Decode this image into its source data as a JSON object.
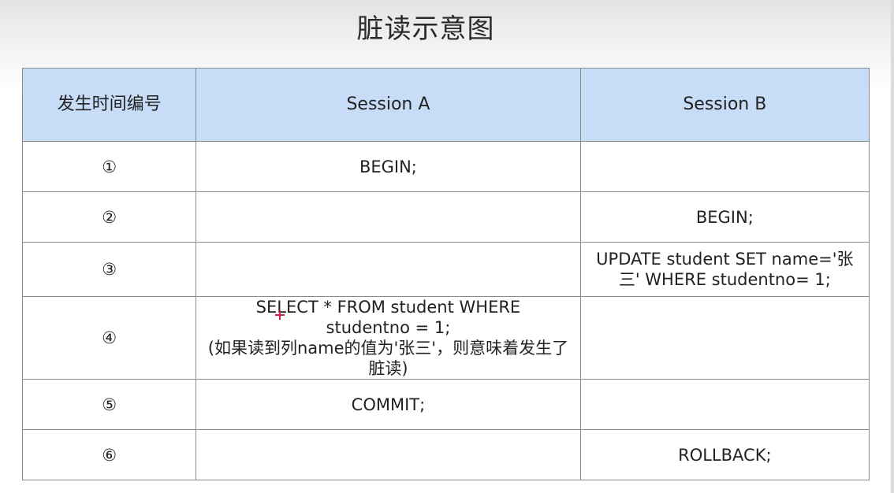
{
  "slide": {
    "title": "脏读示意图"
  },
  "table": {
    "headers": {
      "step": "发生时间编号",
      "session_a": "Session A",
      "session_b": "Session B"
    },
    "rows": [
      {
        "step": "①",
        "session_a": "BEGIN;",
        "session_b": ""
      },
      {
        "step": "②",
        "session_a": "",
        "session_b": "BEGIN;"
      },
      {
        "step": "③",
        "session_a": "",
        "session_b_lines": [
          "UPDATE student SET name='张",
          "三' WHERE studentno= 1;"
        ]
      },
      {
        "step": "④",
        "session_a_lines": [
          "SELECT * FROM student WHERE",
          "studentno = 1;",
          "(如果读到列name的值为'张三'，则意味着发生了",
          "脏读)"
        ],
        "session_b": ""
      },
      {
        "step": "⑤",
        "session_a": "COMMIT;",
        "session_b": ""
      },
      {
        "step": "⑥",
        "session_a": "",
        "session_b": "ROLLBACK;"
      }
    ]
  },
  "colors": {
    "header_background": "#c6dcf7",
    "border": "#8a8a8a",
    "cursor": "#d0204a"
  },
  "icons": {
    "cursor": "crosshair-cursor-icon"
  }
}
